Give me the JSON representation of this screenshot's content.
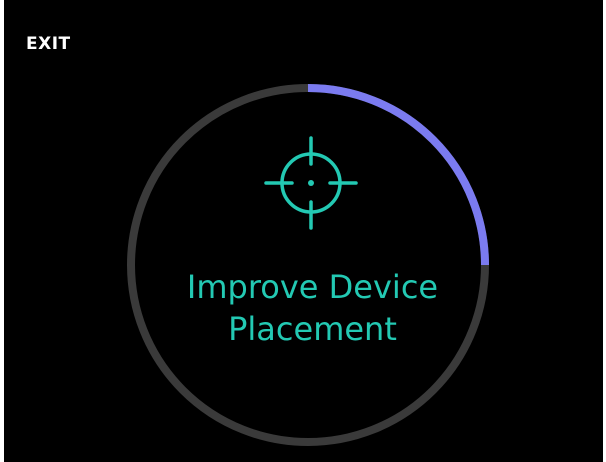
{
  "header": {
    "exit_label": "EXIT"
  },
  "main": {
    "headline_line1": "Improve Device",
    "headline_line2": "Placement",
    "icon": "crosshair-target-icon",
    "progress_fraction": 0.25
  },
  "colors": {
    "background": "#000000",
    "ring_track": "#3a3a3a",
    "ring_progress": "#7b7bf0",
    "accent": "#23c9b3",
    "exit_text": "#ffffff"
  }
}
